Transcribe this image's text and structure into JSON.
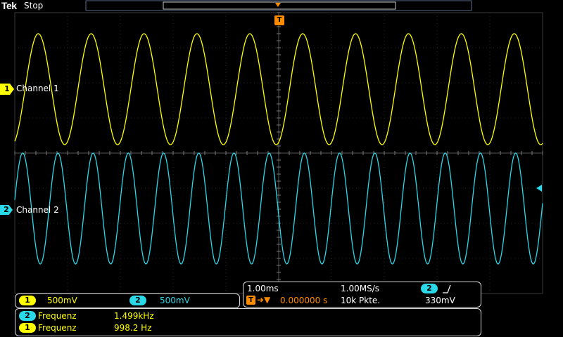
{
  "header": {
    "brand": "Tek",
    "acquisition_state": "Stop"
  },
  "channels": [
    {
      "id": "1",
      "label": "Channel 1",
      "color": "#ffff00",
      "scale": "500mV"
    },
    {
      "id": "2",
      "label": "Channel 2",
      "color": "#2ad8e8",
      "scale": "500mV"
    }
  ],
  "trigger": {
    "marker": "T",
    "position": "0.000000 s",
    "source": "2",
    "slope": "rising",
    "level": "330mV"
  },
  "timebase": {
    "horizontal_scale": "1.00ms",
    "sample_rate": "1.00MS/s",
    "record_length": "10k Pkte."
  },
  "measurements": [
    {
      "channel": "2",
      "name": "Frequenz",
      "value": "1.499kHz"
    },
    {
      "channel": "1",
      "name": "Frequenz",
      "value": "998.2 Hz"
    }
  ]
}
